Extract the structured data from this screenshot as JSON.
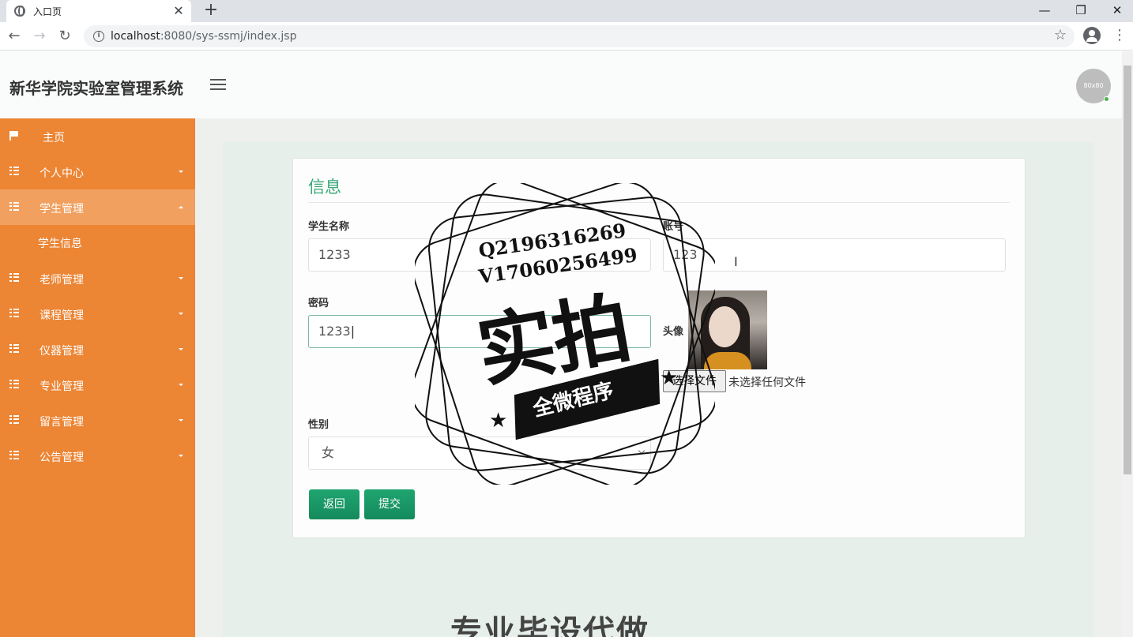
{
  "browser": {
    "tab_title": "入口页",
    "new_tab": "+",
    "close_tab": "✕",
    "url_host": "localhost",
    "url_path": ":8080/sys-ssmj/index.jsp",
    "window_minimize": "—",
    "window_restore": "❐",
    "window_close": "✕"
  },
  "app": {
    "title": "新华学院实验室管理系统",
    "avatar_text": "80x80"
  },
  "sidebar": {
    "items": [
      {
        "label": "主页",
        "icon": "flag-icon"
      },
      {
        "label": "个人中心",
        "icon": "grid-icon"
      },
      {
        "label": "学生管理",
        "icon": "grid-icon",
        "expanded": true
      },
      {
        "label": "老师管理",
        "icon": "grid-icon"
      },
      {
        "label": "课程管理",
        "icon": "grid-icon"
      },
      {
        "label": "仪器管理",
        "icon": "grid-icon"
      },
      {
        "label": "专业管理",
        "icon": "grid-icon"
      },
      {
        "label": "留言管理",
        "icon": "grid-icon"
      },
      {
        "label": "公告管理",
        "icon": "grid-icon"
      }
    ],
    "sub_items": [
      {
        "label": "学生信息"
      }
    ]
  },
  "form": {
    "title": "信息",
    "student_name_label": "学生名称",
    "student_name_value": "1233",
    "account_label": "账号",
    "account_value": "123",
    "password_label": "密码",
    "password_value": "1233",
    "avatar_label": "头像",
    "file_button": "选择文件",
    "file_status": "未选择任何文件",
    "gender_label": "性别",
    "gender_value": "女",
    "back_button": "返回",
    "submit_button": "提交"
  },
  "watermark": {
    "line1": "Q2196316269",
    "line2": "V17060256499",
    "big": "实拍",
    "ribbon": "全微程序",
    "bottom": "专业毕设代做"
  },
  "colors": {
    "sidebar": "#ec8534",
    "sidebar_active": "#f1a05f",
    "accent_green": "#3aa87a",
    "button_green": "#1a9a66"
  }
}
